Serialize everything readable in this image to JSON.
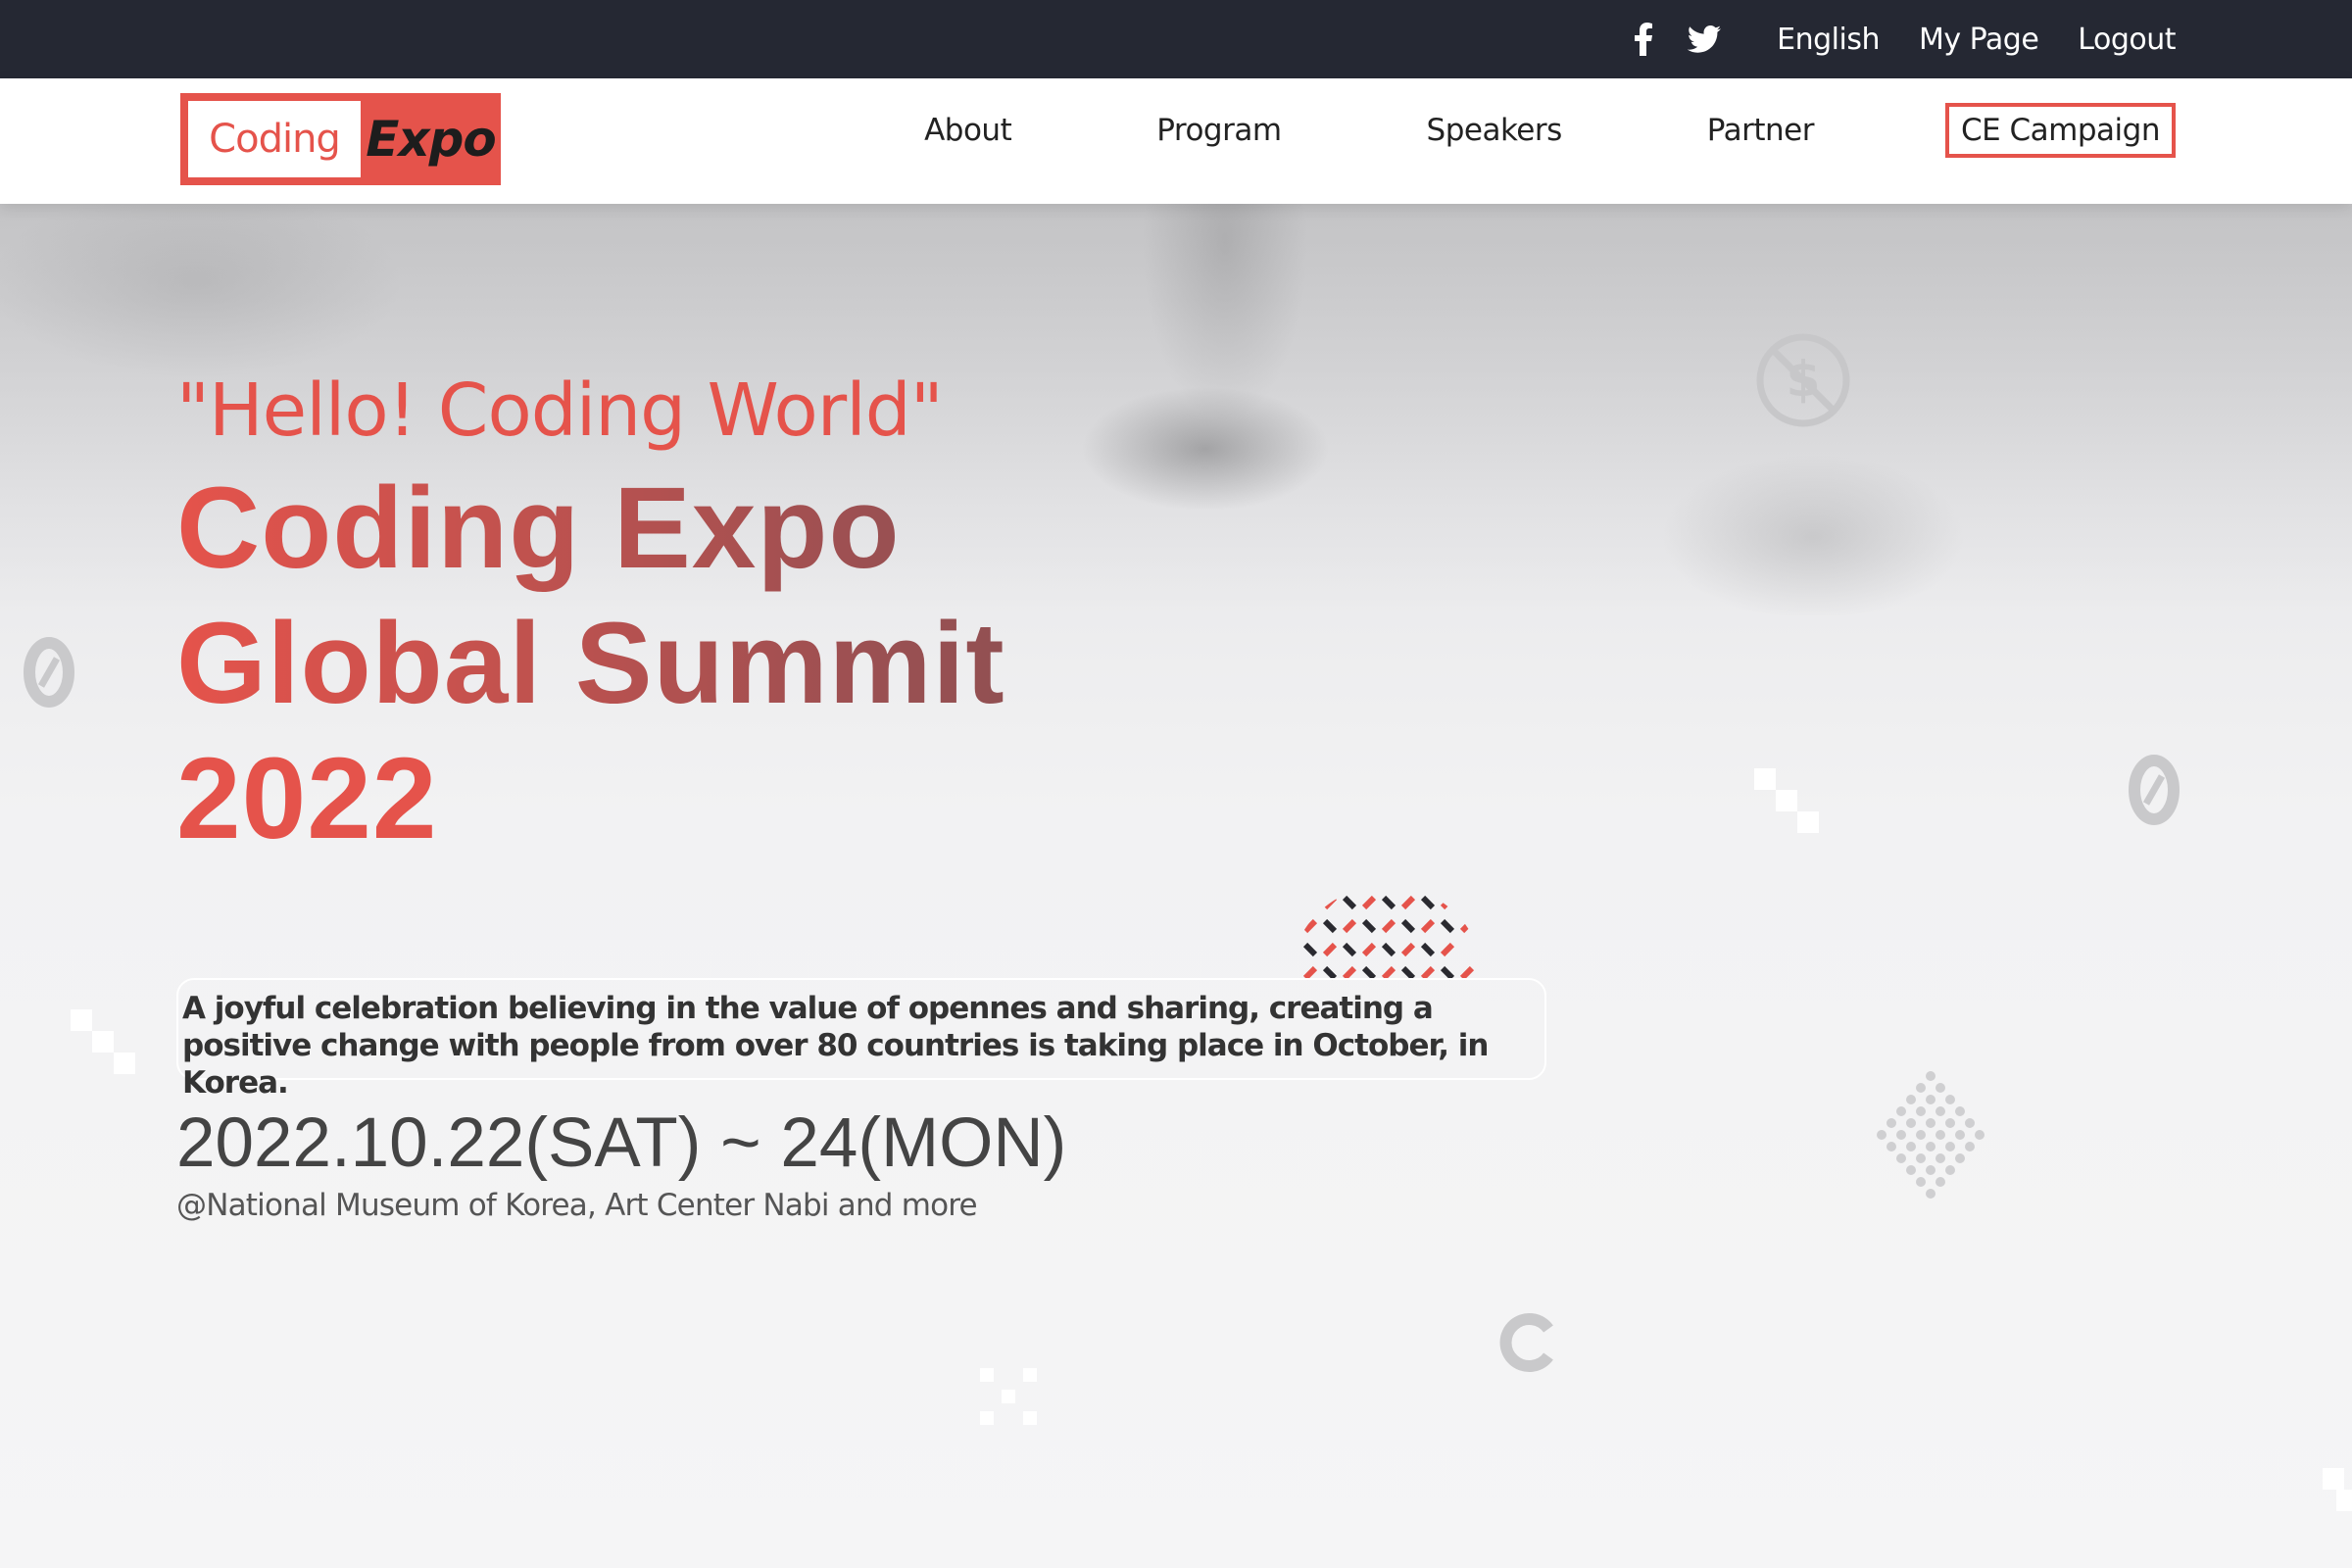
{
  "topbar": {
    "icons": [
      "facebook-icon",
      "twitter-icon"
    ],
    "links": [
      "English",
      "My Page",
      "Logout"
    ]
  },
  "nav": {
    "logo": {
      "left": "Coding",
      "right": "Expo"
    },
    "items": [
      "About",
      "Program",
      "Speakers",
      "Partner",
      "CE Campaign"
    ],
    "highlighted_item": "CE Campaign"
  },
  "hero": {
    "quote": "\"Hello! Coding World\"",
    "title_lines": [
      "Coding Expo",
      "Global Summit",
      "2022"
    ],
    "description": "A joyful celebration believing in the value of opennes and sharing, creating a positive change with people from over 80 countries is taking place in October, in Korea.",
    "date": "2022.10.22(SAT) ~ 24(MON)",
    "venue": "@National Museum of Korea, Art Center Nabi and more"
  },
  "colors": {
    "accent": "#e5534b",
    "topbar_bg": "#252833",
    "title_gradient_end": "#7a4f54"
  }
}
